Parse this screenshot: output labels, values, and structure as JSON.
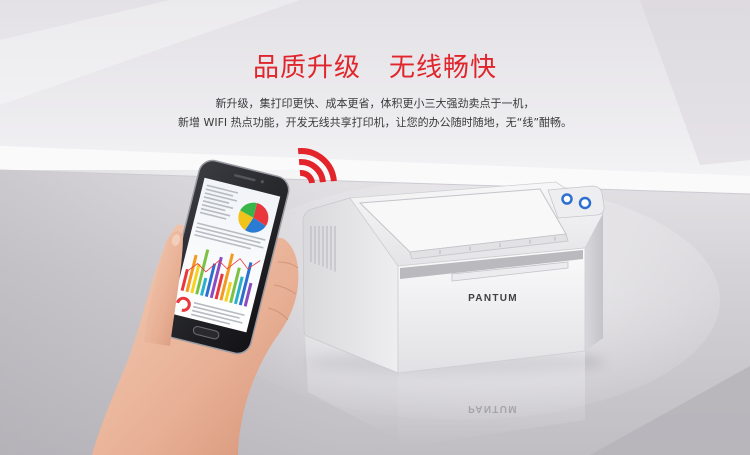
{
  "banner": {
    "title_part1": "品质升级",
    "title_part2": "无线畅快",
    "description_lines": [
      "新升级，集打印更快、成本更省，体积更小三大强劲卖点于一机，",
      "新增 WIFI 热点功能，开发无线共享打印机，让您的办公随时随地，无“线”酣畅。"
    ]
  },
  "printer": {
    "brand": "PANTUM",
    "button_color": "#2f6fd0"
  },
  "icons": {
    "wireless_signal": "wifi-signal-icon",
    "phone": "smartphone"
  },
  "colors": {
    "headline": "#e0262c",
    "description": "#3a3a3a",
    "wireless_signal": "#e3252b"
  }
}
